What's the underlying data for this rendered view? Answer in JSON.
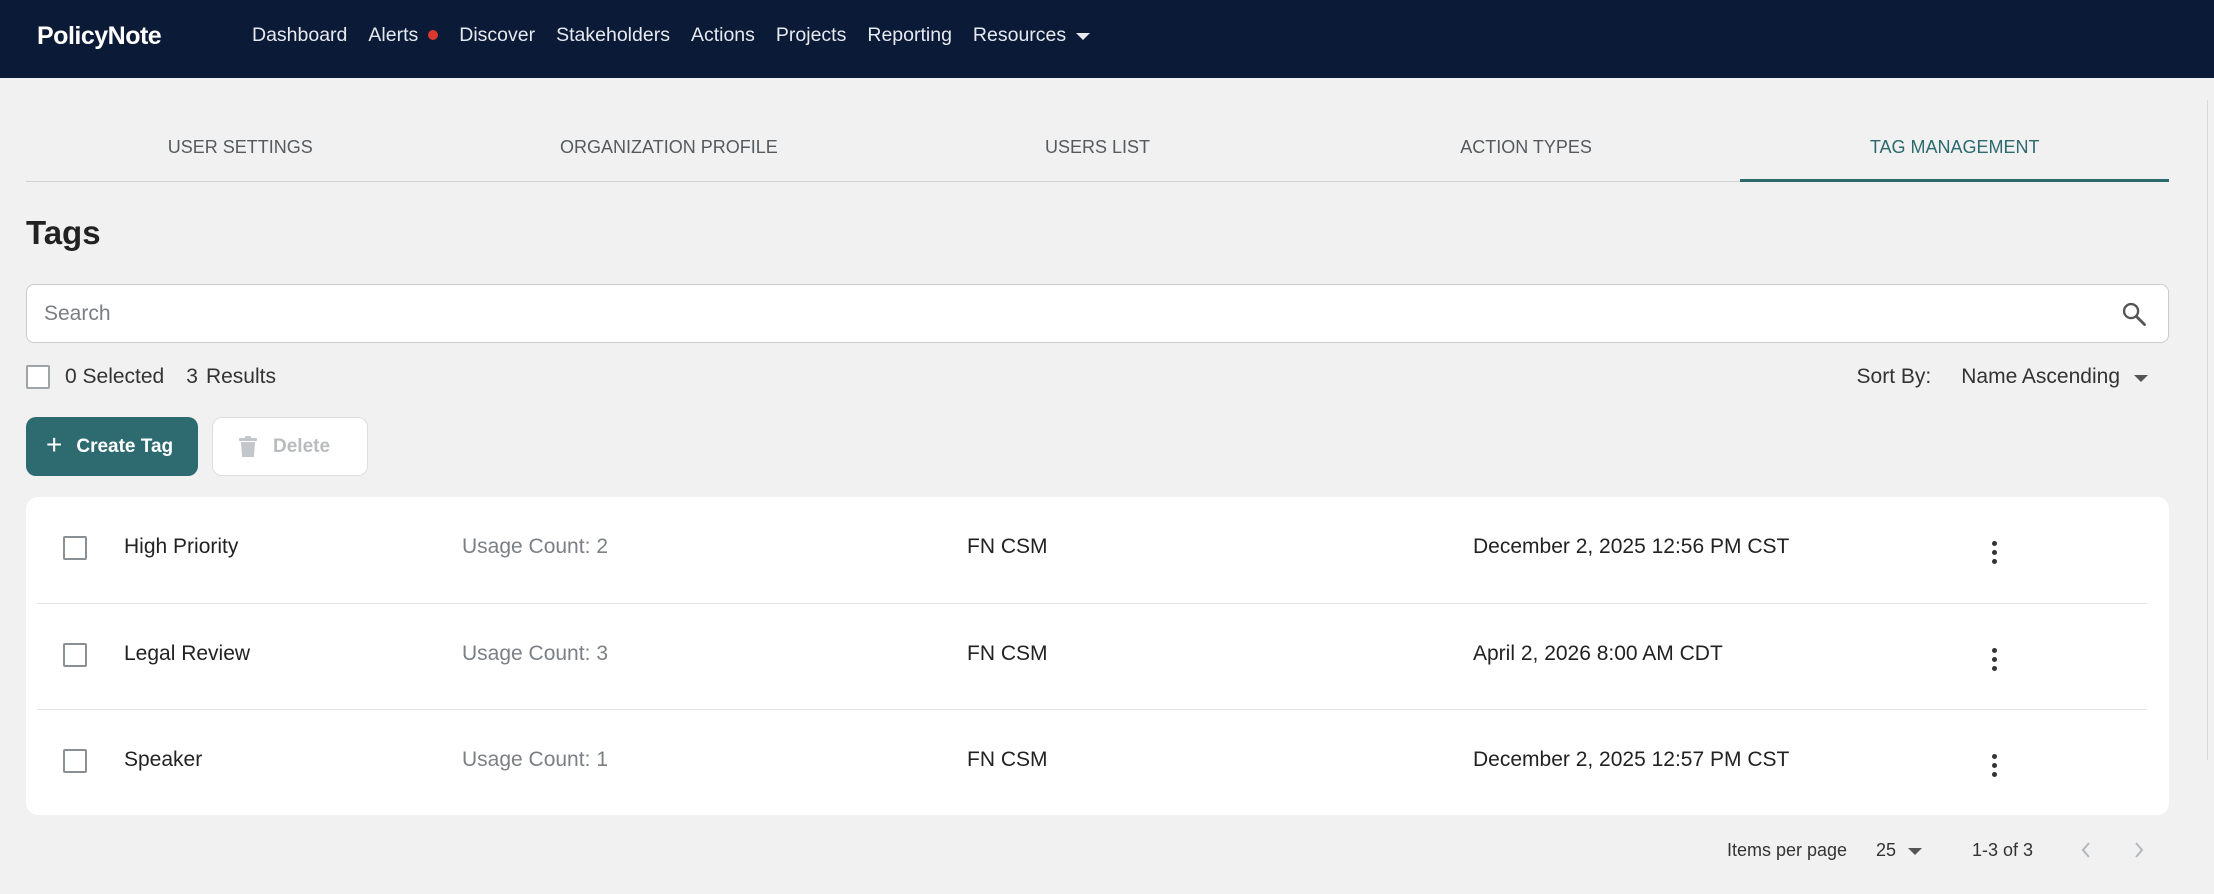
{
  "app": {
    "brand": "PolicyNote"
  },
  "nav": {
    "items": [
      {
        "label": "Dashboard"
      },
      {
        "label": "Alerts"
      },
      {
        "label": "Discover"
      },
      {
        "label": "Stakeholders"
      },
      {
        "label": "Actions"
      },
      {
        "label": "Projects"
      },
      {
        "label": "Reporting"
      },
      {
        "label": "Resources"
      }
    ]
  },
  "tabs": [
    {
      "label": "USER SETTINGS"
    },
    {
      "label": "ORGANIZATION PROFILE"
    },
    {
      "label": "USERS LIST"
    },
    {
      "label": "ACTION TYPES"
    },
    {
      "label": "TAG MANAGEMENT",
      "active": true
    }
  ],
  "page": {
    "title": "Tags"
  },
  "search": {
    "placeholder": "Search",
    "value": ""
  },
  "selection": {
    "selected_text": "0 Selected",
    "results_count": "3",
    "results_label": "Results"
  },
  "sort": {
    "label": "Sort By:",
    "value": "Name Ascending"
  },
  "toolbar": {
    "create_label": "Create Tag",
    "delete_label": "Delete"
  },
  "tags": [
    {
      "name": "High Priority",
      "usage_label": "Usage Count:",
      "usage_count": "2",
      "owner": "FN CSM",
      "date": "December 2, 2025 12:56 PM CST"
    },
    {
      "name": "Legal Review",
      "usage_label": "Usage Count:",
      "usage_count": "3",
      "owner": "FN CSM",
      "date": "April 2, 2026 8:00 AM CDT"
    },
    {
      "name": "Speaker",
      "usage_label": "Usage Count:",
      "usage_count": "1",
      "owner": "FN CSM",
      "date": "December 2, 2025 12:57 PM CST"
    }
  ],
  "pagination": {
    "items_per_page_label": "Items per page",
    "page_size": "25",
    "range": "1-3 of 3"
  },
  "colors": {
    "nav_bg": "#0b1a36",
    "accent": "#2d6b70",
    "alert_dot": "#d9382c",
    "page_bg": "#f1f1f1"
  },
  "icons": {
    "search": "search-icon",
    "delete": "trash-icon",
    "more": "more-vertical-icon",
    "prev": "chevron-left-icon",
    "next": "chevron-right-icon"
  }
}
